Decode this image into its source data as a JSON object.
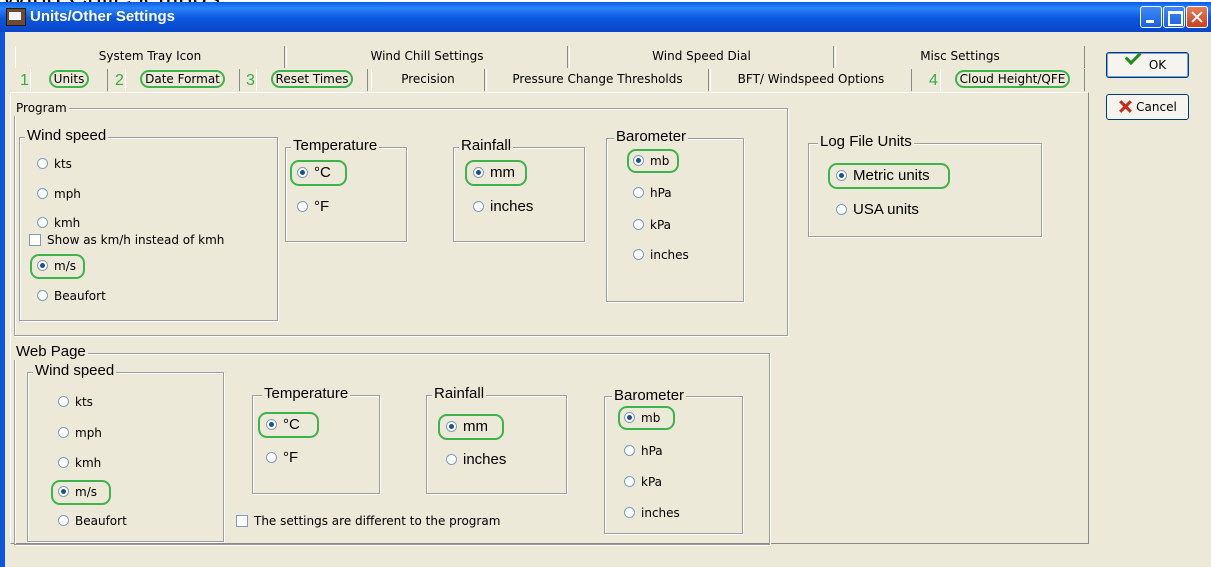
{
  "caption": "Wind Chill Settings",
  "window": {
    "title": "Units/Other Settings"
  },
  "tabs_row1": [
    "System Tray Icon",
    "Wind Chill Settings",
    "Wind Speed Dial",
    "Misc Settings"
  ],
  "tabs_row2": [
    "Units",
    "Date Format",
    "Reset Times",
    "Precision",
    "Pressure Change Thresholds",
    "BFT/ Windspeed Options",
    "Cloud Height/QFE"
  ],
  "tab_numbers": [
    "1",
    "2",
    "3",
    "4"
  ],
  "buttons": {
    "ok": "OK",
    "cancel": "Cancel"
  },
  "program": {
    "label": "Program",
    "wind_speed": {
      "label": "Wind speed",
      "options": [
        "kts",
        "mph",
        "kmh",
        "m/s",
        "Beaufort"
      ],
      "selected": "m/s",
      "checkbox": "Show as km/h instead of kmh"
    },
    "temperature": {
      "label": "Temperature",
      "options": [
        "°C",
        "°F"
      ],
      "selected": "°C"
    },
    "rainfall": {
      "label": "Rainfall",
      "options": [
        "mm",
        "inches"
      ],
      "selected": "mm"
    },
    "barometer": {
      "label": "Barometer",
      "options": [
        "mb",
        "hPa",
        "kPa",
        "inches"
      ],
      "selected": "mb"
    },
    "log_file": {
      "label": "Log File Units",
      "options": [
        "Metric units",
        "USA units"
      ],
      "selected": "Metric units"
    }
  },
  "web_page": {
    "label": "Web Page",
    "wind_speed": {
      "label": "Wind speed",
      "options": [
        "kts",
        "mph",
        "kmh",
        "m/s",
        "Beaufort"
      ],
      "selected": "m/s"
    },
    "temperature": {
      "label": "Temperature",
      "options": [
        "°C",
        "°F"
      ],
      "selected": "°C"
    },
    "rainfall": {
      "label": "Rainfall",
      "options": [
        "mm",
        "inches"
      ],
      "selected": "mm"
    },
    "barometer": {
      "label": "Barometer",
      "options": [
        "mb",
        "hPa",
        "kPa",
        "inches"
      ],
      "selected": "mb"
    },
    "different_checkbox": "The settings are different to the program"
  }
}
